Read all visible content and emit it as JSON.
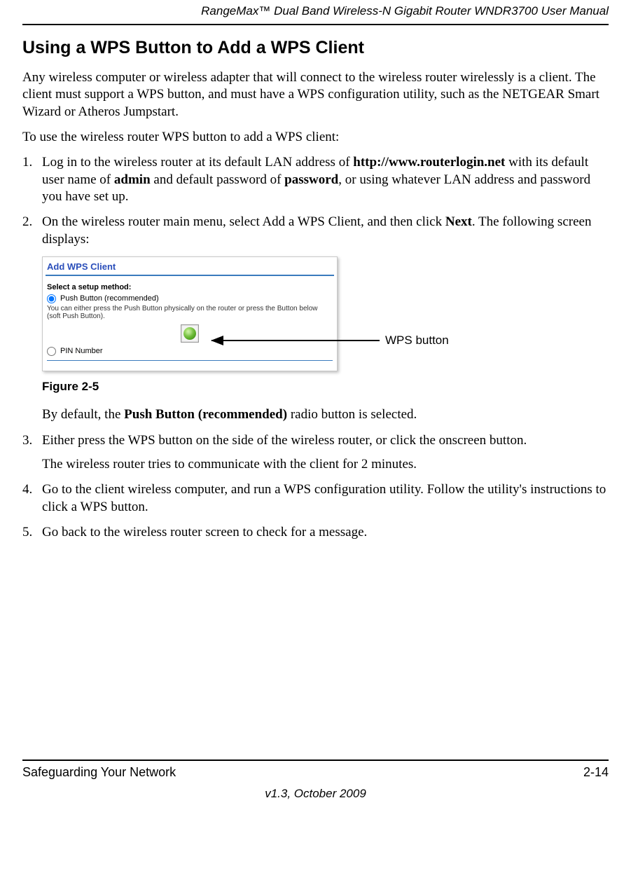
{
  "header": {
    "product": "RangeMax™ Dual Band Wireless-N Gigabit Router WNDR3700 User Manual"
  },
  "section": {
    "title": "Using a WPS Button to Add a WPS Client"
  },
  "intro": {
    "p1": "Any wireless computer or wireless adapter that will connect to the wireless router wirelessly is a client. The client must support a WPS button, and must have a WPS configuration utility, such as the NETGEAR Smart Wizard or Atheros Jumpstart.",
    "p2": "To use the wireless router WPS button to add a WPS client:"
  },
  "steps": {
    "s1": {
      "num": "1.",
      "t1": "Log in to the wireless router at its default LAN address of ",
      "b1": "http://www.routerlogin.net",
      "t2": " with its default user name of ",
      "b2": "admin",
      "t3": " and default password of ",
      "b3": "password",
      "t4": ", or using whatever LAN address and password you have set up."
    },
    "s2": {
      "num": "2.",
      "t1": "On the wireless router main menu, select Add a WPS Client, and then click ",
      "b1": "Next",
      "t2": ". The following screen displays:",
      "sub": {
        "t1": "By default, the ",
        "b1": "Push Button (recommended)",
        "t2": " radio button is selected."
      }
    },
    "s3": {
      "num": "3.",
      "t1": "Either press the WPS button on the side of the wireless router, or click the onscreen button.",
      "sub": "The wireless router tries to communicate with the client for 2 minutes."
    },
    "s4": {
      "num": "4.",
      "t1": "Go to the client wireless computer, and run a WPS configuration utility. Follow the utility's instructions to click a WPS button."
    },
    "s5": {
      "num": "5.",
      "t1": "Go back to the wireless router screen to check for a message."
    }
  },
  "figure": {
    "caption": "Figure 2-5",
    "callout": "WPS button",
    "panel": {
      "title": "Add WPS Client",
      "method_label": "Select a setup method:",
      "option_push": "Push Button (recommended)",
      "push_desc": "You can either press the Push Button physically on the router or press the Button below (soft Push Button).",
      "option_pin": "PIN Number"
    }
  },
  "footer": {
    "left": "Safeguarding Your Network",
    "right": "2-14",
    "version": "v1.3, October 2009"
  }
}
